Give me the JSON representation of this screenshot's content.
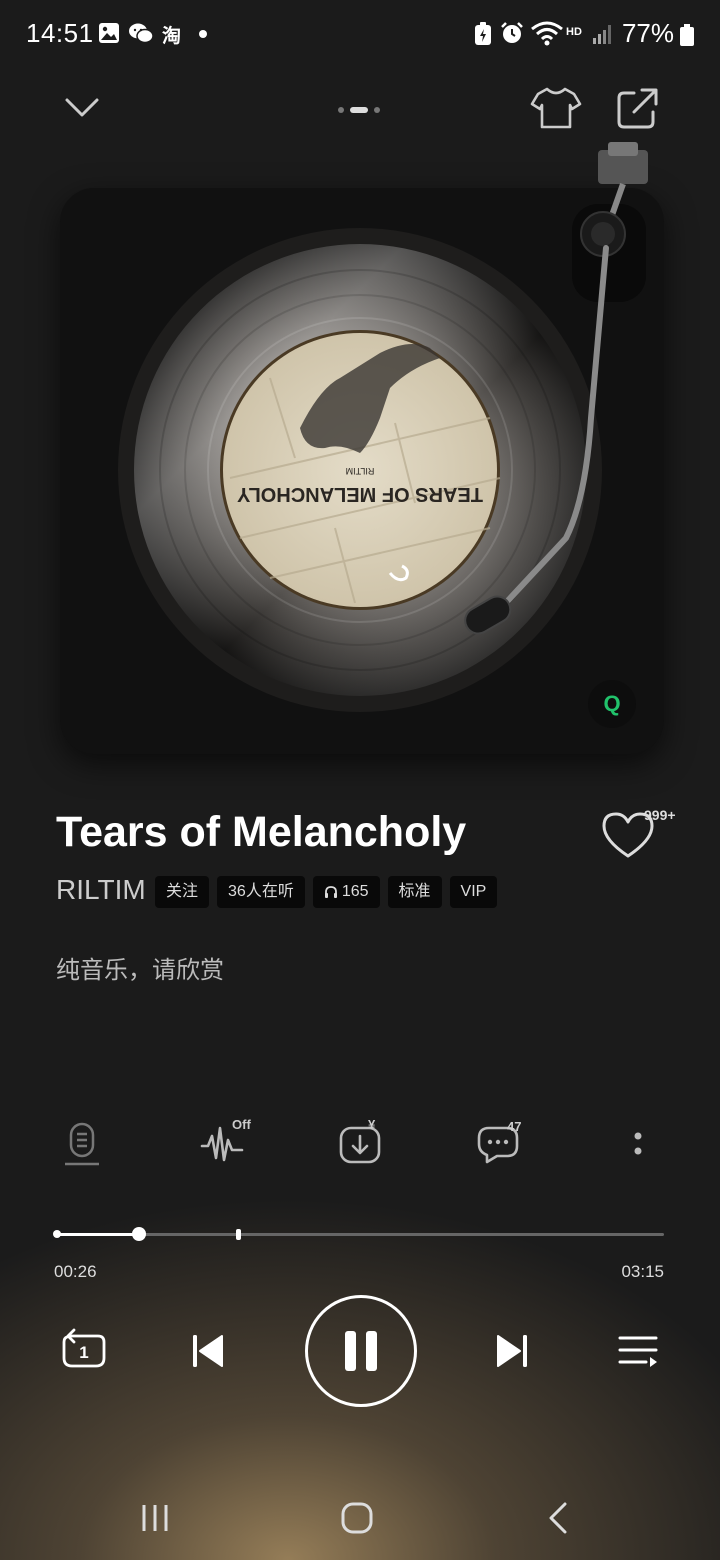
{
  "status_bar": {
    "time": "14:51",
    "app_icon_taobao": "淘",
    "hd_label": "HD",
    "battery_percent": "77%"
  },
  "top_bar": {
    "active_page_index": 1,
    "page_count": 3
  },
  "album": {
    "cover_title": "TEARS OF MELANCHOLY",
    "cover_artist": "RILTIM",
    "badge_label": "Q",
    "badge_color": "#21c26b"
  },
  "song": {
    "title": "Tears of Melancholy",
    "artist": "RILTIM",
    "like_count": "999+",
    "tags": {
      "follow": "关注",
      "listeners": "36人在听",
      "plays": "165",
      "quality": "标准",
      "vip": "VIP"
    },
    "lyric": "纯音乐，请欣赏"
  },
  "actions": {
    "effect_badge": "Off",
    "download_badge": "¥",
    "comments_badge": "47"
  },
  "progress": {
    "current": "00:26",
    "total": "03:15",
    "fraction": 0.137,
    "marker_fraction": 0.3
  },
  "controls": {
    "repeat_count": "1"
  },
  "colors": {
    "background": "#1b1b1b",
    "accent_glow": "#aa8e62"
  }
}
